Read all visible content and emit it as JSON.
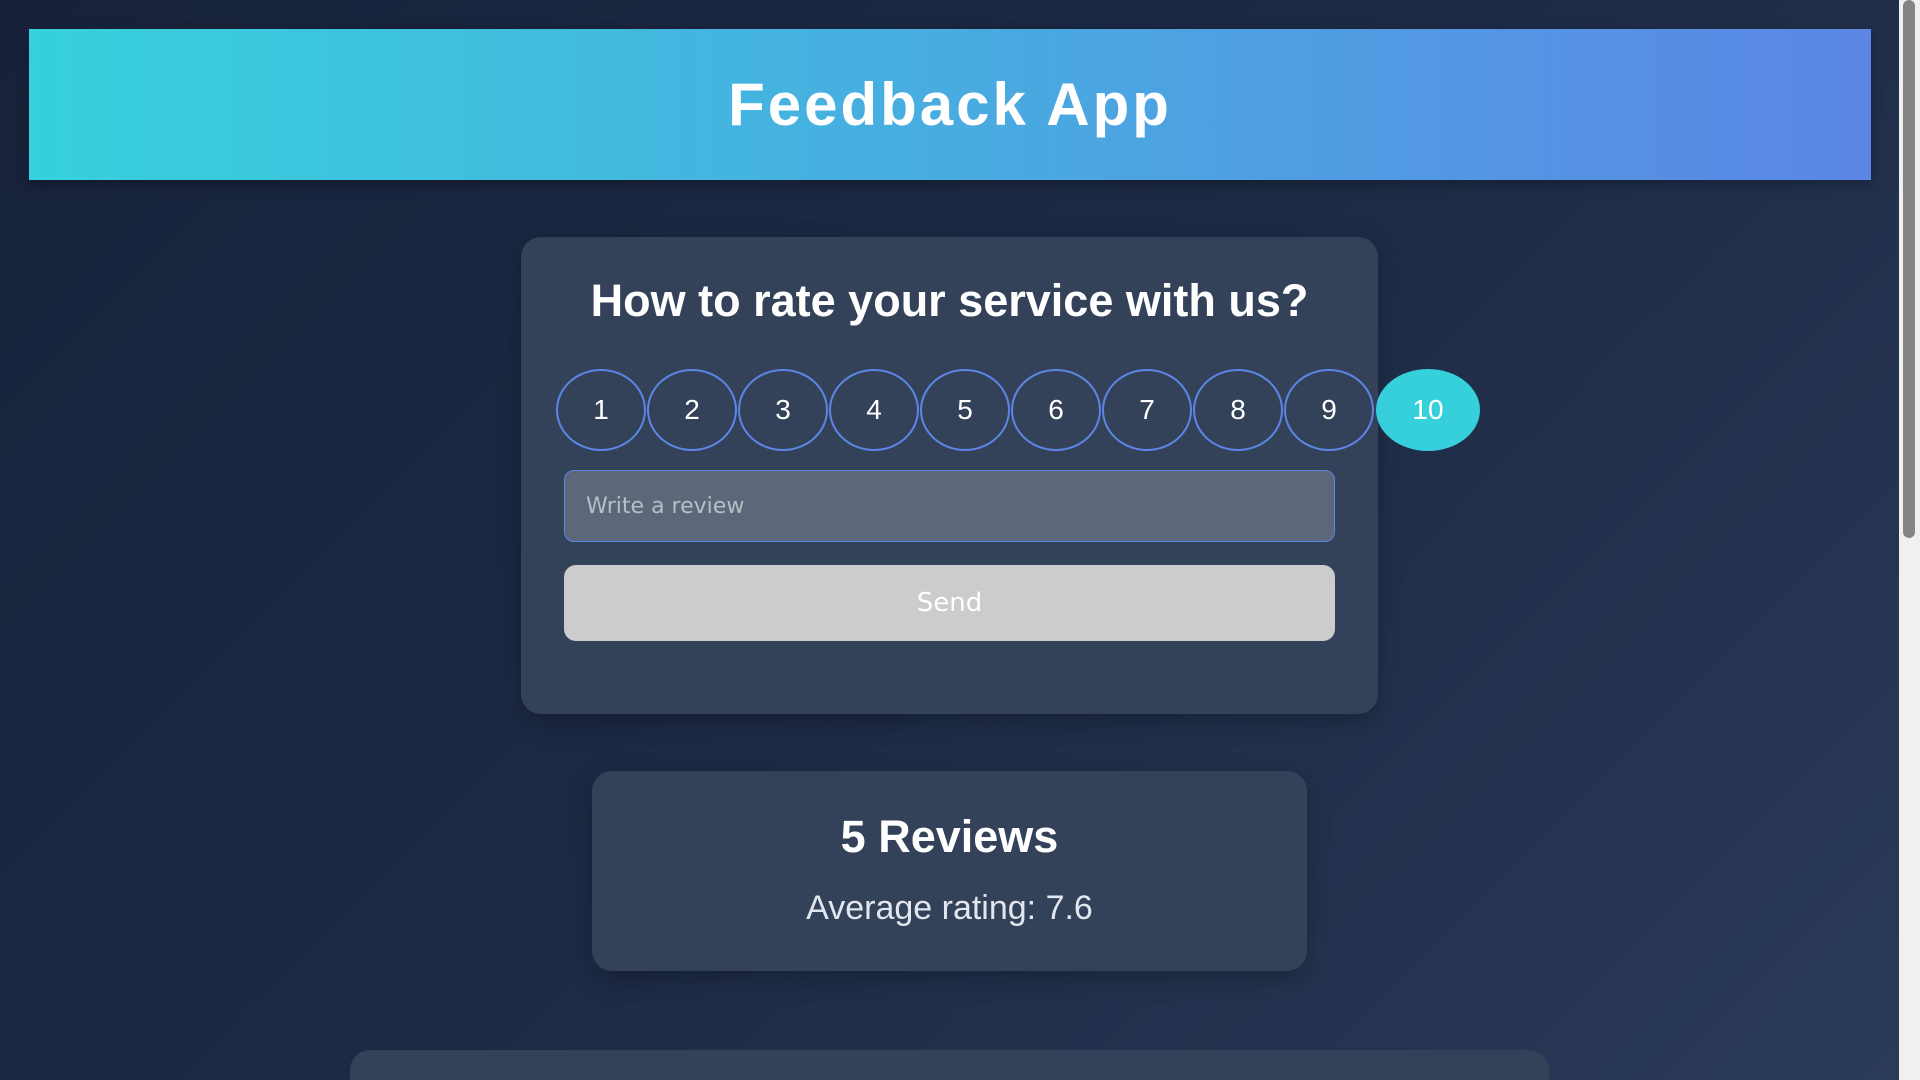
{
  "header": {
    "title": "Feedback App"
  },
  "feedback_form": {
    "question": "How to rate your service with us?",
    "ratings": [
      "1",
      "2",
      "3",
      "4",
      "5",
      "6",
      "7",
      "8",
      "9",
      "10"
    ],
    "selected_rating": "10",
    "review_input": {
      "value": "",
      "placeholder": "Write a review"
    },
    "send_label": "Send"
  },
  "stats": {
    "reviews_title": "5 Reviews",
    "average_label": "Average rating: ",
    "average_value": "7.6"
  },
  "colors": {
    "header_gradient_start": "#36d1dc",
    "header_gradient_end": "#5b86e5",
    "selected_rating": "#36cfdc",
    "rating_border": "#5b86e5",
    "send_button_disabled": "#cccccc",
    "card_background": "#334259"
  }
}
